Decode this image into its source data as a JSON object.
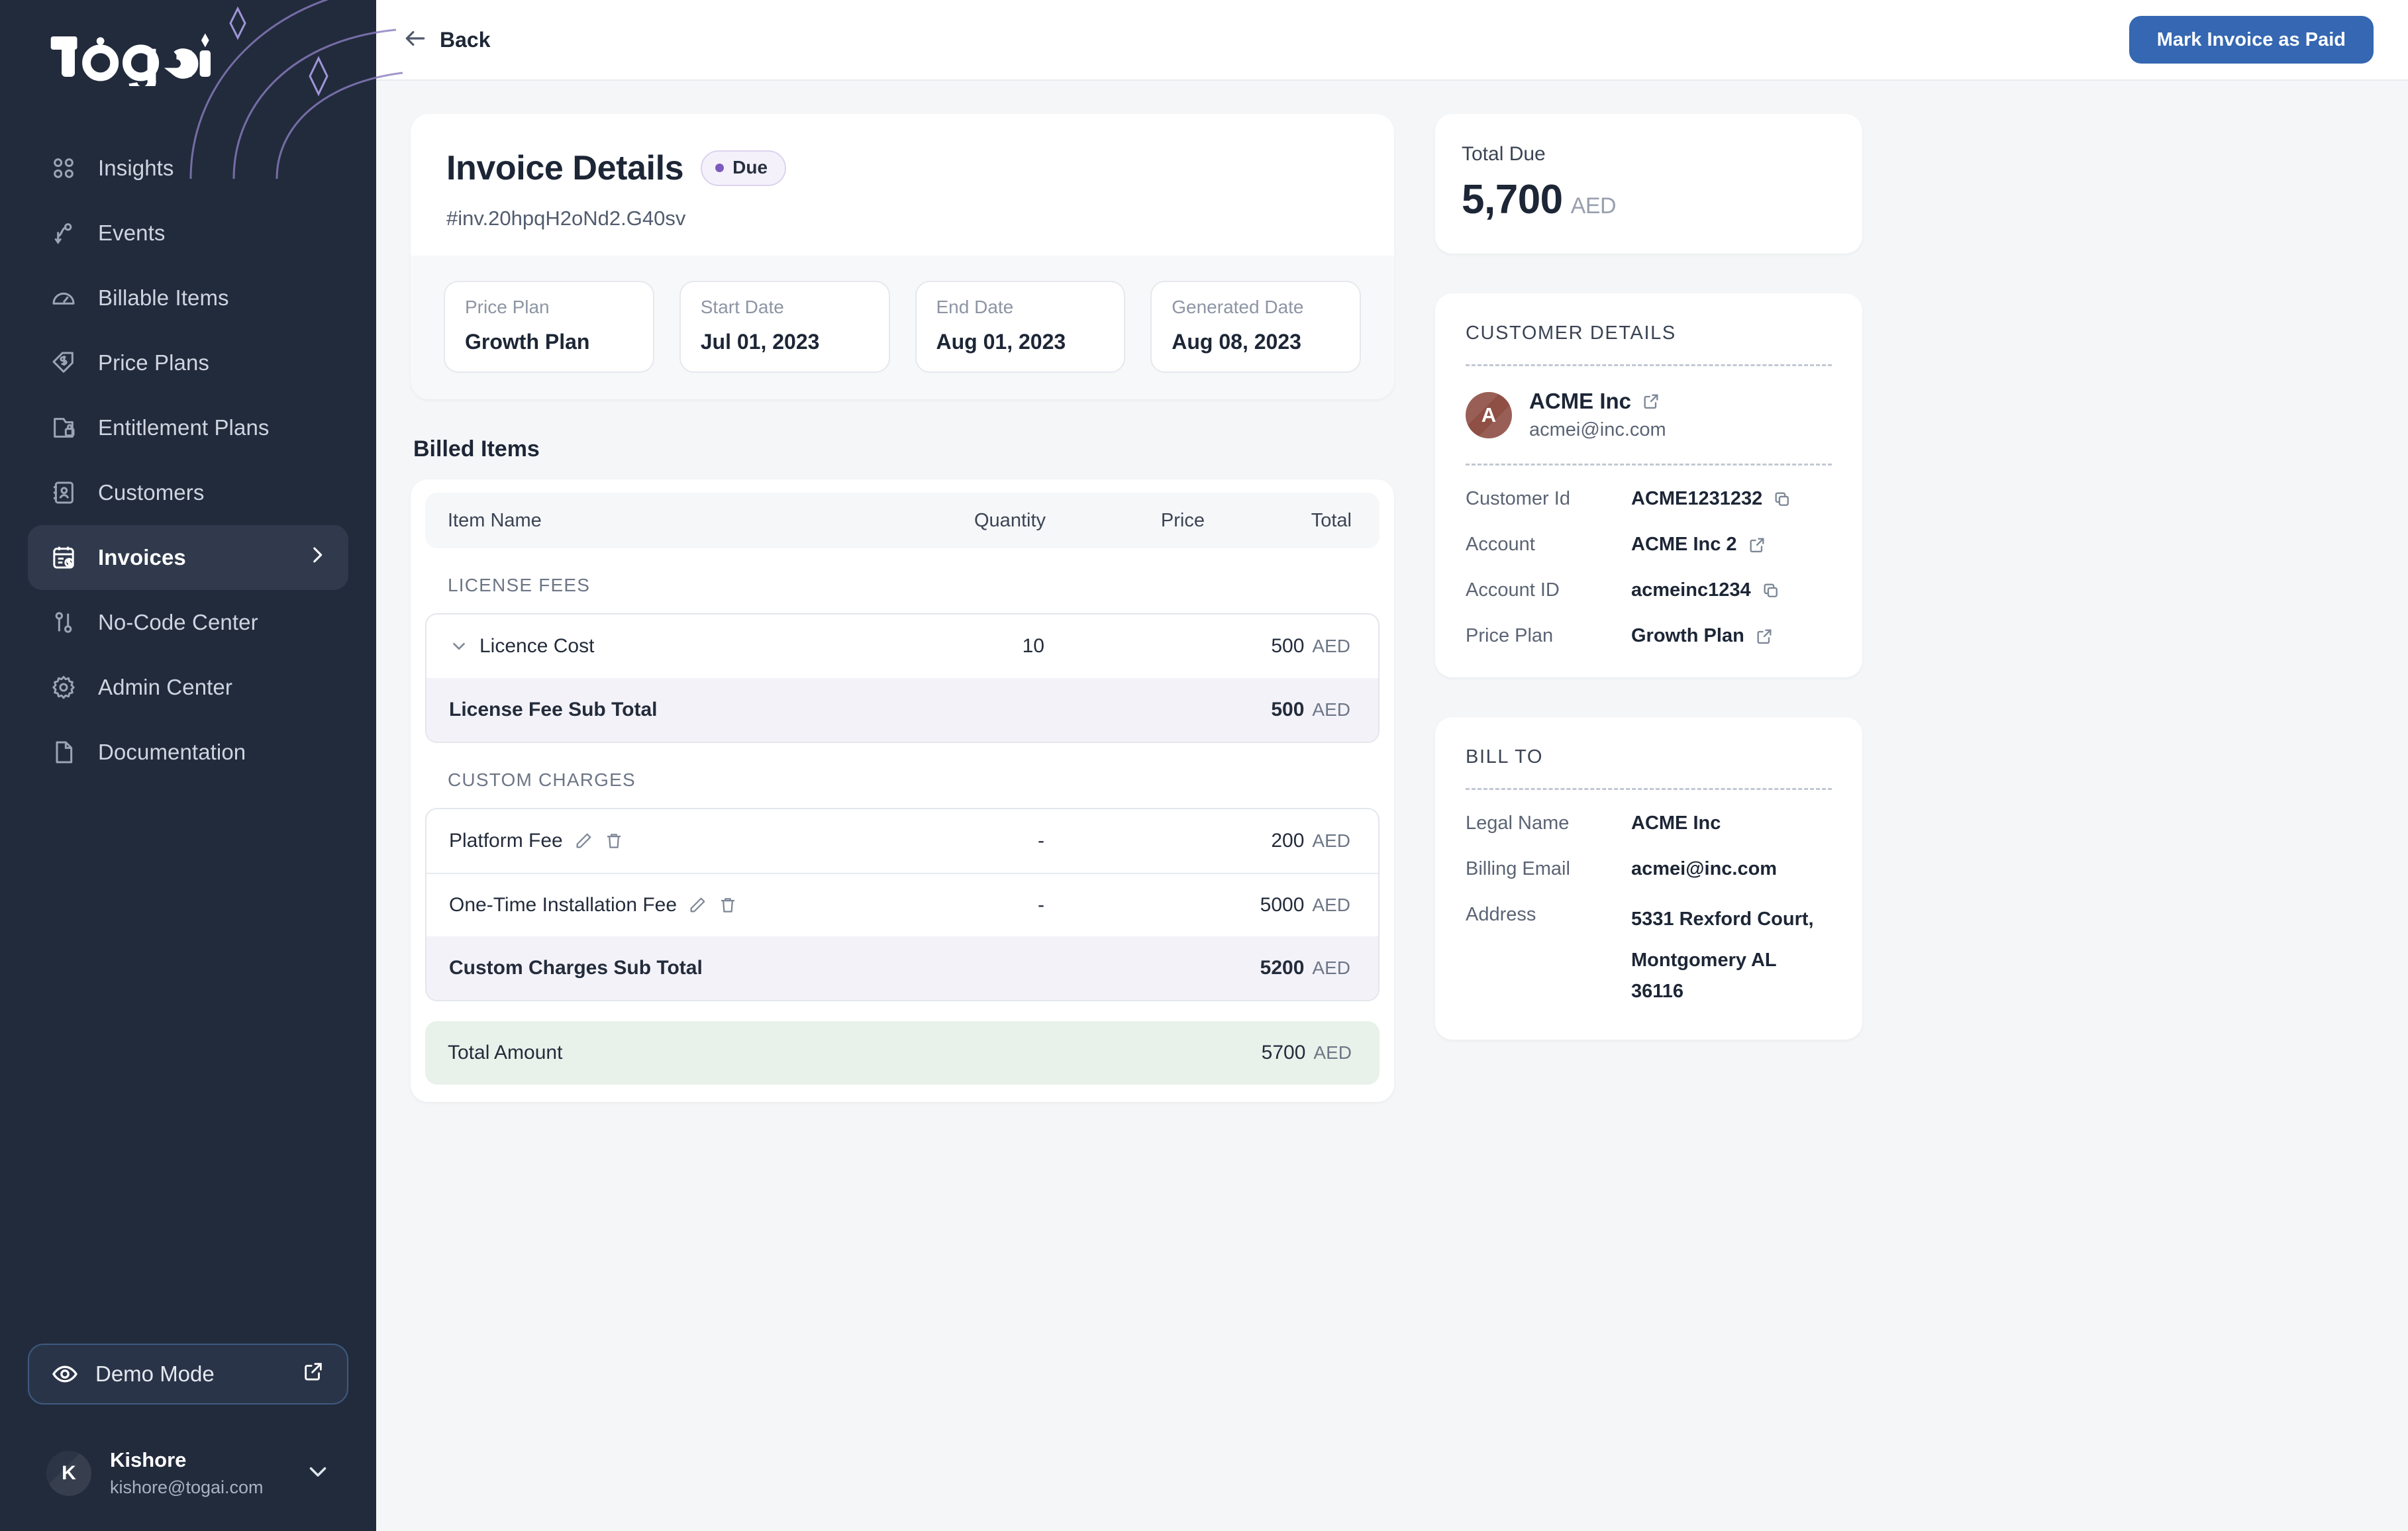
{
  "brand": {
    "name": "Togai",
    "accent": "#3567b2",
    "sidebar_bg": "#222b3c"
  },
  "sidebar": {
    "items": [
      {
        "label": "Insights",
        "icon": "grid-icon",
        "active": false
      },
      {
        "label": "Events",
        "icon": "events-flow-icon",
        "active": false
      },
      {
        "label": "Billable Items",
        "icon": "gauge-icon",
        "active": false
      },
      {
        "label": "Price Plans",
        "icon": "tag-dollar-icon",
        "active": false
      },
      {
        "label": "Entitlement Plans",
        "icon": "folder-lock-icon",
        "active": false
      },
      {
        "label": "Customers",
        "icon": "contact-book-icon",
        "active": false
      },
      {
        "label": "Invoices",
        "icon": "invoice-calendar-icon",
        "active": true
      },
      {
        "label": "No-Code Center",
        "icon": "toggles-icon",
        "active": false
      },
      {
        "label": "Admin Center",
        "icon": "gear-icon",
        "active": false
      },
      {
        "label": "Documentation",
        "icon": "document-icon",
        "active": false
      }
    ],
    "demo_mode": {
      "label": "Demo Mode"
    },
    "user": {
      "initial": "K",
      "name": "Kishore",
      "email": "kishore@togai.com"
    }
  },
  "topbar": {
    "back_label": "Back",
    "primary_action": "Mark Invoice as Paid"
  },
  "invoice": {
    "title": "Invoice Details",
    "status": "Due",
    "id": "#inv.20hpqH2oNd2.G40sv",
    "meta": [
      {
        "label": "Price Plan",
        "value": "Growth Plan"
      },
      {
        "label": "Start Date",
        "value": "Jul 01, 2023"
      },
      {
        "label": "End Date",
        "value": "Aug 01, 2023"
      },
      {
        "label": "Generated Date",
        "value": "Aug 08, 2023"
      }
    ]
  },
  "billed_items": {
    "section_title": "Billed Items",
    "columns": {
      "name": "Item Name",
      "quantity": "Quantity",
      "price": "Price",
      "total": "Total"
    },
    "groups": [
      {
        "label": "LICENSE FEES",
        "rows": [
          {
            "name": "Licence Cost",
            "quantity": "10",
            "price": "",
            "total": "500",
            "currency": "AED",
            "expandable": true,
            "editable": false
          }
        ],
        "subtotal": {
          "name": "License Fee Sub Total",
          "total": "500",
          "currency": "AED"
        }
      },
      {
        "label": "CUSTOM CHARGES",
        "rows": [
          {
            "name": "Platform Fee",
            "quantity": "-",
            "price": "",
            "total": "200",
            "currency": "AED",
            "expandable": false,
            "editable": true
          },
          {
            "name": "One-Time Installation Fee",
            "quantity": "-",
            "price": "",
            "total": "5000",
            "currency": "AED",
            "expandable": false,
            "editable": true
          }
        ],
        "subtotal": {
          "name": "Custom Charges Sub Total",
          "total": "5200",
          "currency": "AED"
        }
      }
    ],
    "total": {
      "name": "Total Amount",
      "total": "5700",
      "currency": "AED"
    }
  },
  "total_due": {
    "label": "Total Due",
    "amount": "5,700",
    "currency": "AED"
  },
  "customer_details": {
    "title": "CUSTOMER DETAILS",
    "avatar_initial": "A",
    "name": "ACME Inc",
    "email": "acmei@inc.com",
    "fields": [
      {
        "label": "Customer Id",
        "value": "ACME1231232",
        "action": "copy-icon"
      },
      {
        "label": "Account",
        "value": "ACME Inc 2",
        "action": "external-link-icon"
      },
      {
        "label": "Account ID",
        "value": "acmeinc1234",
        "action": "copy-icon"
      },
      {
        "label": "Price Plan",
        "value": "Growth Plan",
        "action": "external-link-icon"
      }
    ]
  },
  "bill_to": {
    "title": "BILL TO",
    "fields": [
      {
        "label": "Legal Name",
        "value": "ACME Inc"
      },
      {
        "label": "Billing Email",
        "value": "acmei@inc.com"
      }
    ],
    "address_label": "Address",
    "address_line1": "5331 Rexford Court,",
    "address_line2": "Montgomery AL 36116"
  }
}
